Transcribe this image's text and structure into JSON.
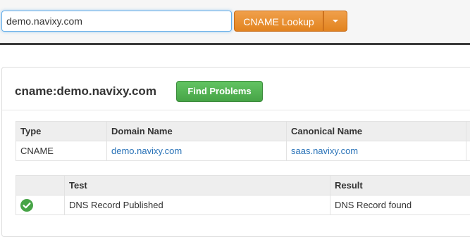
{
  "search": {
    "value": "demo.navixy.com",
    "lookup_label": "CNAME Lookup"
  },
  "result": {
    "title": "cname:demo.navixy.com",
    "find_problems_label": "Find Problems"
  },
  "record_table": {
    "headers": [
      "Type",
      "Domain Name",
      "Canonical Name"
    ],
    "rows": [
      {
        "type": "CNAME",
        "domain_name": "demo.navixy.com",
        "canonical_name": "saas.navixy.com"
      }
    ]
  },
  "test_table": {
    "headers": [
      "",
      "Test",
      "Result"
    ],
    "rows": [
      {
        "status_icon": "check-circle-icon",
        "test": "DNS Record Published",
        "result": "DNS Record found"
      }
    ]
  },
  "colors": {
    "lookup_button": "#e8902f",
    "find_problems_button": "#52b152",
    "link": "#2a73b8",
    "success": "#47a447"
  }
}
